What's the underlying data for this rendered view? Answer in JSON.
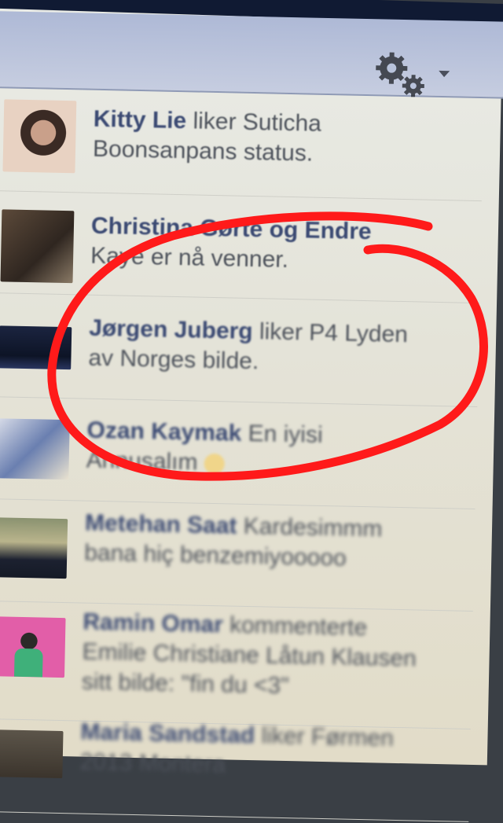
{
  "toolbar": {
    "settings_icon": "gear-icon",
    "dropdown_icon": "chevron-down-icon"
  },
  "ticker": {
    "stories": [
      {
        "name": "Kitty Lie",
        "action": " liker Suticha",
        "line2": "Boonsanpans status."
      },
      {
        "name": "Christina Gørte og Endre",
        "action": "",
        "line2": "Kaye er nå venner."
      },
      {
        "name": "Jørgen Juberg",
        "action": " liker P4 Lyden",
        "line2": "av Norges bilde."
      },
      {
        "name": "Ozan Kaymak",
        "action": " En iyisi",
        "line2": "Annusalım"
      },
      {
        "name": "Metehan Saat",
        "action": " Kardesimmm",
        "line2": "bana hiç benzemiyooooo"
      },
      {
        "name": "Ramin Omar",
        "action": " kommenterte",
        "line2": "Emilie Christiane Låtun Klausen",
        "line3": "sitt bilde: \"fin du <3\""
      },
      {
        "name": "Maria Sandstad",
        "action": " liker Førmen",
        "line2": "2013 Montera"
      }
    ]
  },
  "colors": {
    "accent_circle": "#ff1a1a",
    "name_color": "#3b4a73",
    "header_bg": "#b8c2db"
  }
}
